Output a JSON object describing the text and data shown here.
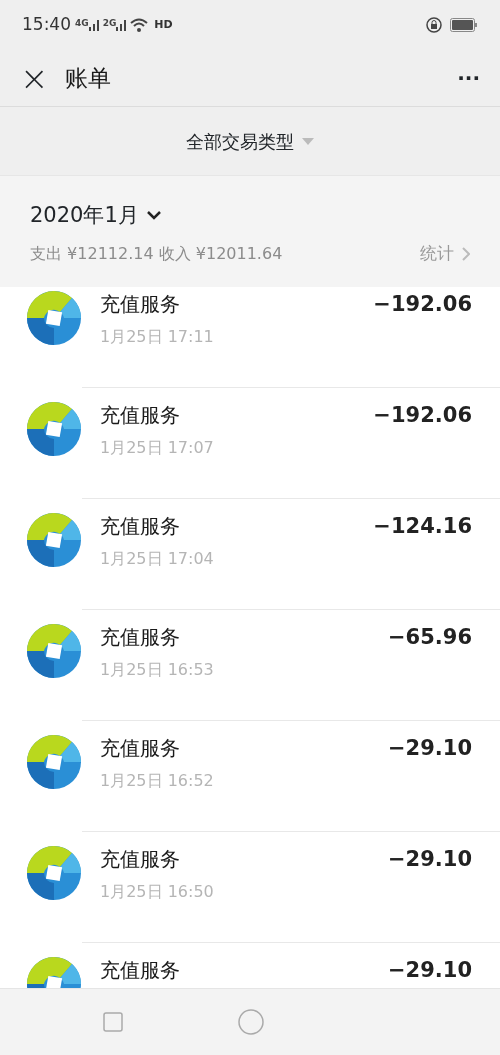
{
  "status_bar": {
    "time": "15:40",
    "networks": [
      "4G",
      "2G"
    ],
    "hd": "HD"
  },
  "header": {
    "title": "账单",
    "close": "×",
    "more": "···"
  },
  "filter": {
    "label": "全部交易类型"
  },
  "month": {
    "title": "2020年1月",
    "summary": "支出 ¥12112.14 收入 ¥12011.64",
    "stats": "统计"
  },
  "transactions": [
    {
      "name": "充值服务",
      "time": "1月25日 17:11",
      "amount": "−192.06"
    },
    {
      "name": "充值服务",
      "time": "1月25日 17:07",
      "amount": "−192.06"
    },
    {
      "name": "充值服务",
      "time": "1月25日 17:04",
      "amount": "−124.16"
    },
    {
      "name": "充值服务",
      "time": "1月25日 16:53",
      "amount": "−65.96"
    },
    {
      "name": "充值服务",
      "time": "1月25日 16:52",
      "amount": "−29.10"
    },
    {
      "name": "充值服务",
      "time": "1月25日 16:50",
      "amount": "−29.10"
    },
    {
      "name": "充值服务",
      "amount": "−29.10"
    }
  ]
}
